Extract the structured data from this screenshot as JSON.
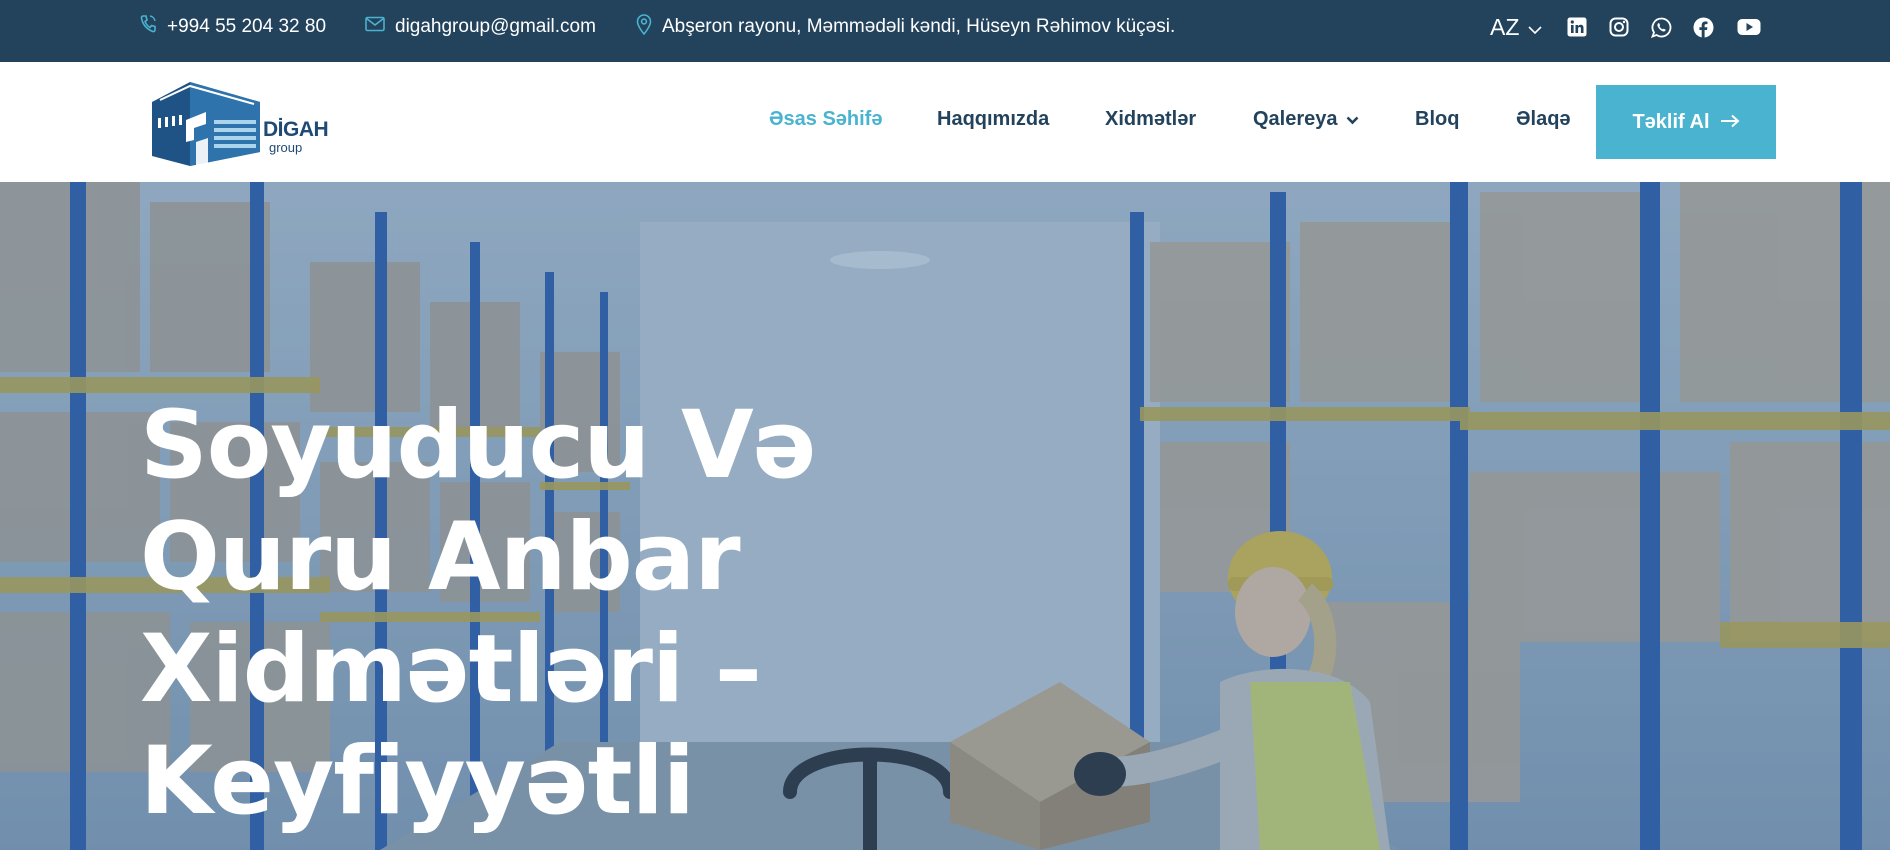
{
  "topbar": {
    "phone": "+994 55 204 32 80",
    "email": "digahgroup@gmail.com",
    "address": "Abşeron rayonu, Məmmədəli kəndi, Hüseyn Rəhimov küçəsi.",
    "language": "AZ",
    "social": [
      "linkedin-icon",
      "instagram-icon",
      "whatsapp-icon",
      "facebook-icon",
      "youtube-icon"
    ]
  },
  "logo": {
    "name": "DİGAH",
    "sub": "group"
  },
  "nav": {
    "home": "Əsas Səhifə",
    "about": "Haqqımızda",
    "services": "Xidmətlər",
    "gallery": "Qalereya",
    "blog": "Bloq",
    "contact": "Əlaqə",
    "cta": "Təklif Al"
  },
  "hero": {
    "title": "Soyuducu Və Quru Anbar Xidmətləri – Keyfiyyətli"
  },
  "colors": {
    "topbar_bg": "#23435d",
    "accent": "#4ab3cf",
    "nav_text": "#23435d"
  }
}
